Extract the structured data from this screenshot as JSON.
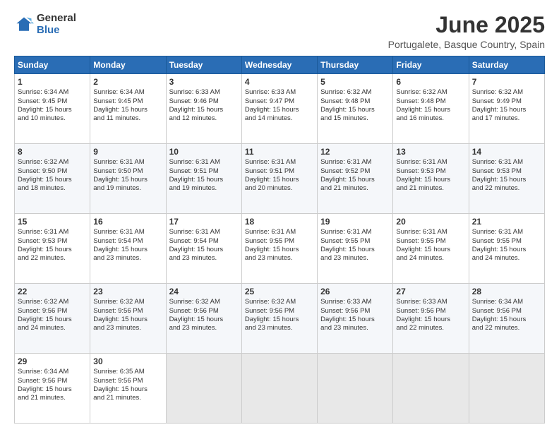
{
  "logo": {
    "general": "General",
    "blue": "Blue"
  },
  "title": "June 2025",
  "subtitle": "Portugalete, Basque Country, Spain",
  "weekdays": [
    "Sunday",
    "Monday",
    "Tuesday",
    "Wednesday",
    "Thursday",
    "Friday",
    "Saturday"
  ],
  "weeks": [
    [
      {
        "day": "1",
        "info": "Sunrise: 6:34 AM\nSunset: 9:45 PM\nDaylight: 15 hours\nand 10 minutes."
      },
      {
        "day": "2",
        "info": "Sunrise: 6:34 AM\nSunset: 9:45 PM\nDaylight: 15 hours\nand 11 minutes."
      },
      {
        "day": "3",
        "info": "Sunrise: 6:33 AM\nSunset: 9:46 PM\nDaylight: 15 hours\nand 12 minutes."
      },
      {
        "day": "4",
        "info": "Sunrise: 6:33 AM\nSunset: 9:47 PM\nDaylight: 15 hours\nand 14 minutes."
      },
      {
        "day": "5",
        "info": "Sunrise: 6:32 AM\nSunset: 9:48 PM\nDaylight: 15 hours\nand 15 minutes."
      },
      {
        "day": "6",
        "info": "Sunrise: 6:32 AM\nSunset: 9:48 PM\nDaylight: 15 hours\nand 16 minutes."
      },
      {
        "day": "7",
        "info": "Sunrise: 6:32 AM\nSunset: 9:49 PM\nDaylight: 15 hours\nand 17 minutes."
      }
    ],
    [
      {
        "day": "8",
        "info": "Sunrise: 6:32 AM\nSunset: 9:50 PM\nDaylight: 15 hours\nand 18 minutes."
      },
      {
        "day": "9",
        "info": "Sunrise: 6:31 AM\nSunset: 9:50 PM\nDaylight: 15 hours\nand 19 minutes."
      },
      {
        "day": "10",
        "info": "Sunrise: 6:31 AM\nSunset: 9:51 PM\nDaylight: 15 hours\nand 19 minutes."
      },
      {
        "day": "11",
        "info": "Sunrise: 6:31 AM\nSunset: 9:51 PM\nDaylight: 15 hours\nand 20 minutes."
      },
      {
        "day": "12",
        "info": "Sunrise: 6:31 AM\nSunset: 9:52 PM\nDaylight: 15 hours\nand 21 minutes."
      },
      {
        "day": "13",
        "info": "Sunrise: 6:31 AM\nSunset: 9:53 PM\nDaylight: 15 hours\nand 21 minutes."
      },
      {
        "day": "14",
        "info": "Sunrise: 6:31 AM\nSunset: 9:53 PM\nDaylight: 15 hours\nand 22 minutes."
      }
    ],
    [
      {
        "day": "15",
        "info": "Sunrise: 6:31 AM\nSunset: 9:53 PM\nDaylight: 15 hours\nand 22 minutes."
      },
      {
        "day": "16",
        "info": "Sunrise: 6:31 AM\nSunset: 9:54 PM\nDaylight: 15 hours\nand 23 minutes."
      },
      {
        "day": "17",
        "info": "Sunrise: 6:31 AM\nSunset: 9:54 PM\nDaylight: 15 hours\nand 23 minutes."
      },
      {
        "day": "18",
        "info": "Sunrise: 6:31 AM\nSunset: 9:55 PM\nDaylight: 15 hours\nand 23 minutes."
      },
      {
        "day": "19",
        "info": "Sunrise: 6:31 AM\nSunset: 9:55 PM\nDaylight: 15 hours\nand 23 minutes."
      },
      {
        "day": "20",
        "info": "Sunrise: 6:31 AM\nSunset: 9:55 PM\nDaylight: 15 hours\nand 24 minutes."
      },
      {
        "day": "21",
        "info": "Sunrise: 6:31 AM\nSunset: 9:55 PM\nDaylight: 15 hours\nand 24 minutes."
      }
    ],
    [
      {
        "day": "22",
        "info": "Sunrise: 6:32 AM\nSunset: 9:56 PM\nDaylight: 15 hours\nand 24 minutes."
      },
      {
        "day": "23",
        "info": "Sunrise: 6:32 AM\nSunset: 9:56 PM\nDaylight: 15 hours\nand 23 minutes."
      },
      {
        "day": "24",
        "info": "Sunrise: 6:32 AM\nSunset: 9:56 PM\nDaylight: 15 hours\nand 23 minutes."
      },
      {
        "day": "25",
        "info": "Sunrise: 6:32 AM\nSunset: 9:56 PM\nDaylight: 15 hours\nand 23 minutes."
      },
      {
        "day": "26",
        "info": "Sunrise: 6:33 AM\nSunset: 9:56 PM\nDaylight: 15 hours\nand 23 minutes."
      },
      {
        "day": "27",
        "info": "Sunrise: 6:33 AM\nSunset: 9:56 PM\nDaylight: 15 hours\nand 22 minutes."
      },
      {
        "day": "28",
        "info": "Sunrise: 6:34 AM\nSunset: 9:56 PM\nDaylight: 15 hours\nand 22 minutes."
      }
    ],
    [
      {
        "day": "29",
        "info": "Sunrise: 6:34 AM\nSunset: 9:56 PM\nDaylight: 15 hours\nand 21 minutes."
      },
      {
        "day": "30",
        "info": "Sunrise: 6:35 AM\nSunset: 9:56 PM\nDaylight: 15 hours\nand 21 minutes."
      },
      {
        "day": "",
        "info": ""
      },
      {
        "day": "",
        "info": ""
      },
      {
        "day": "",
        "info": ""
      },
      {
        "day": "",
        "info": ""
      },
      {
        "day": "",
        "info": ""
      }
    ]
  ]
}
